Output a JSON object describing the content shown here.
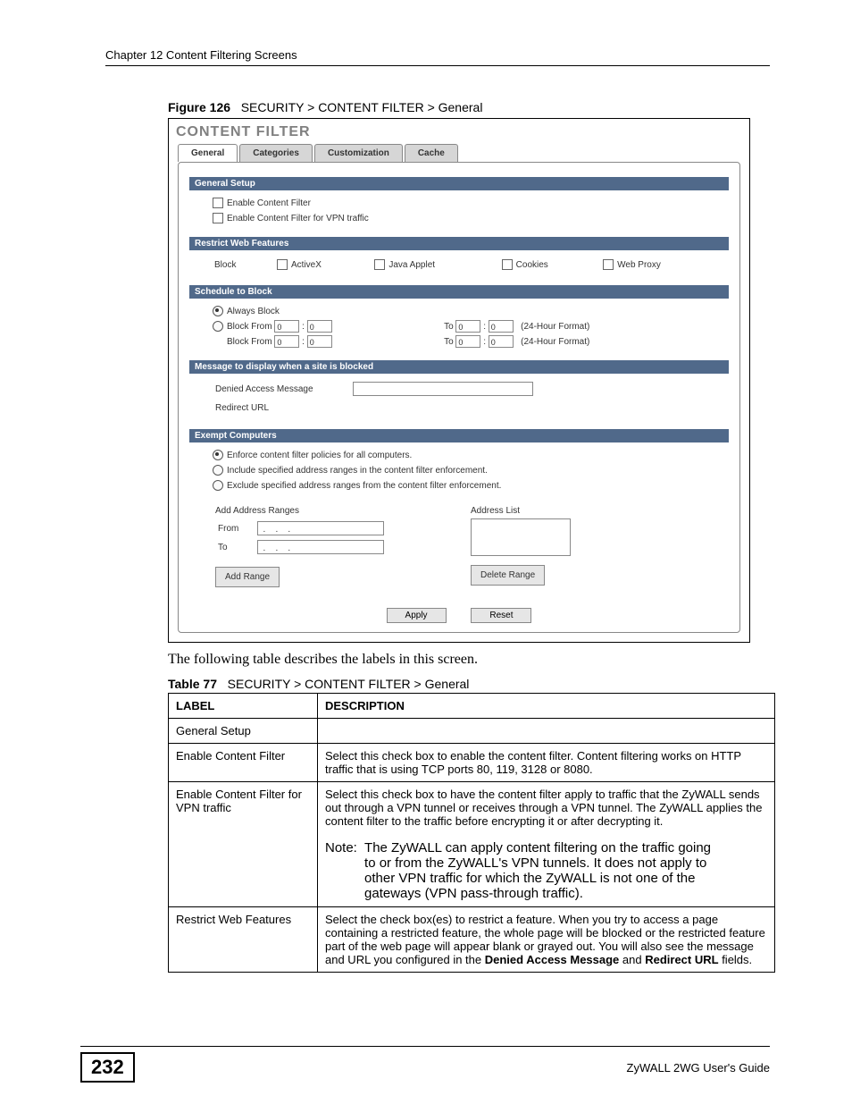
{
  "chapter": "Chapter 12 Content Filtering Screens",
  "figure": {
    "label": "Figure 126",
    "title": "SECURITY > CONTENT FILTER > General"
  },
  "app_title": "CONTENT FILTER",
  "tabs": [
    "General",
    "Categories",
    "Customization",
    "Cache"
  ],
  "sections": {
    "general_setup": {
      "title": "General Setup",
      "enable_cf": "Enable Content Filter",
      "enable_cf_vpn": "Enable Content Filter for VPN traffic"
    },
    "restrict": {
      "title": "Restrict Web Features",
      "block": "Block",
      "items": [
        "ActiveX",
        "Java Applet",
        "Cookies",
        "Web Proxy"
      ]
    },
    "schedule": {
      "title": "Schedule to Block",
      "always": "Always Block",
      "block_from": "Block From",
      "to": "To",
      "hint": "(24-Hour Format)",
      "val": "0"
    },
    "message": {
      "title": "Message to display when a site is blocked",
      "denied": "Denied Access Message",
      "redirect": "Redirect URL"
    },
    "exempt": {
      "title": "Exempt Computers",
      "enforce_all": "Enforce content filter policies for all computers.",
      "include": "Include specified address ranges in the content filter enforcement.",
      "exclude": "Exclude specified address ranges from the content filter enforcement.",
      "add_ranges": "Add Address Ranges",
      "from": "From",
      "to": "To",
      "addr_list": "Address List",
      "add_range_btn": "Add Range",
      "delete_range_btn": "Delete Range"
    },
    "apply": "Apply",
    "reset": "Reset"
  },
  "intro": "The following table describes the labels in this screen.",
  "table_caption": {
    "label": "Table 77",
    "title": "SECURITY > CONTENT FILTER > General"
  },
  "table": {
    "headers": [
      "LABEL",
      "DESCRIPTION"
    ],
    "rows": [
      {
        "label": "General Setup",
        "desc": ""
      },
      {
        "label": "Enable Content Filter",
        "desc": "Select this check box to enable the content filter. Content filtering works on HTTP traffic that is using TCP ports 80, 119, 3128 or 8080."
      },
      {
        "label": "Enable Content Filter for VPN traffic",
        "desc": "Select this check box to have the content filter apply to traffic that the ZyWALL sends out through a VPN tunnel or receives through a VPN tunnel. The ZyWALL applies the content filter to the traffic before encrypting it or after decrypting it.",
        "note": "The ZyWALL can apply content filtering on the traffic going to or from the ZyWALL's VPN tunnels. It does not apply to other VPN traffic for which the ZyWALL is not one of the gateways (VPN pass-through traffic)."
      },
      {
        "label": "Restrict Web Features",
        "desc_html": true,
        "desc": "Select the check box(es) to restrict a feature. When you try to access a page containing a restricted feature, the whole page will be blocked or the restricted feature part of the web page will appear blank or grayed out. You will also see the message and URL you configured in the ",
        "bold1": "Denied Access Message",
        "mid": " and ",
        "bold2": "Redirect URL",
        "tail": " fields."
      }
    ]
  },
  "page_number": "232",
  "guide": "ZyWALL 2WG User's Guide"
}
